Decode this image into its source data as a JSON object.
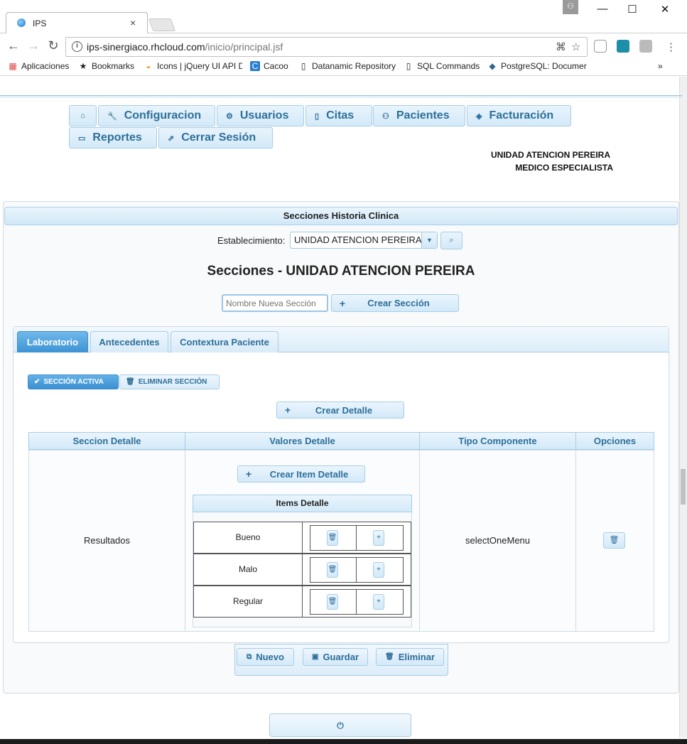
{
  "browser": {
    "tab_title": "IPS",
    "tab_close": "×",
    "url_host": "ips-sinergiaco.rhcloud.com",
    "url_path": "/inicio/principal.jsf",
    "window_controls": {
      "minimize": "—",
      "maximize": "☐",
      "close": "✕"
    },
    "nav": {
      "back": "←",
      "forward": "→",
      "reload": "↻"
    },
    "bookmarks": [
      {
        "label": "Aplicaciones",
        "icon": "apps-grid-icon"
      },
      {
        "label": "Bookmarks",
        "icon": "star-icon"
      },
      {
        "label": "Icons | jQuery UI API D",
        "icon": "jquery-icon"
      },
      {
        "label": "Cacoo",
        "icon": "cacoo-icon"
      },
      {
        "label": "Datanamic Repository",
        "icon": "page-icon"
      },
      {
        "label": "SQL Commands",
        "icon": "page-icon"
      },
      {
        "label": "PostgreSQL: Documer",
        "icon": "postgres-icon"
      }
    ],
    "bookmarks_more": "»"
  },
  "menu": {
    "home_icon": "⌂",
    "items": [
      {
        "label": "Configuracion",
        "icon": "wrench-icon",
        "glyph": "🔧"
      },
      {
        "label": "Usuarios",
        "icon": "gear-icon",
        "glyph": "⚙"
      },
      {
        "label": "Citas",
        "icon": "clipboard-icon",
        "glyph": "▯"
      },
      {
        "label": "Pacientes",
        "icon": "person-icon",
        "glyph": "⚇"
      },
      {
        "label": "Facturación",
        "icon": "tag-icon",
        "glyph": "◈"
      },
      {
        "label": "Reportes",
        "icon": "document-icon",
        "glyph": "▭"
      },
      {
        "label": "Cerrar Sesión",
        "icon": "external-link-icon",
        "glyph": "⇗"
      }
    ]
  },
  "user_info": {
    "unit": "UNIDAD ATENCION PEREIRA",
    "role": "MEDICO ESPECIALISTA"
  },
  "panel": {
    "title": "Secciones Historia Clinica",
    "establishment_label": "Establecimiento:",
    "establishment_value": "UNIDAD ATENCION PEREIRA",
    "heading": "Secciones - UNIDAD ATENCION PEREIRA",
    "new_section_placeholder": "Nombre Nueva Sección",
    "create_section_label": "Crear Sección"
  },
  "tabs": [
    {
      "label": "Laboratorio",
      "active": true
    },
    {
      "label": "Antecedentes",
      "active": false
    },
    {
      "label": "Contextura Paciente",
      "active": false
    }
  ],
  "section_actions": {
    "active_label": "SECCIÓN ACTIVA",
    "delete_label": "ELIMINAR SECCIÓN",
    "create_detail_label": "Crear Detalle"
  },
  "detail_table": {
    "columns": [
      "Seccion Detalle",
      "Valores Detalle",
      "Tipo Componente",
      "Opciones"
    ],
    "rows": [
      {
        "seccion": "Resultados",
        "create_item_label": "Crear Item Detalle",
        "items_title": "Items Detalle",
        "items": [
          "Bueno",
          "Malo",
          "Regular"
        ],
        "tipo": "selectOneMenu"
      }
    ]
  },
  "footer_buttons": {
    "new": "Nuevo",
    "save": "Guardar",
    "delete": "Eliminar"
  },
  "colors": {
    "accent": "#2d6f99",
    "active_tab": "#3d93d4",
    "border": "#a8cde6"
  }
}
